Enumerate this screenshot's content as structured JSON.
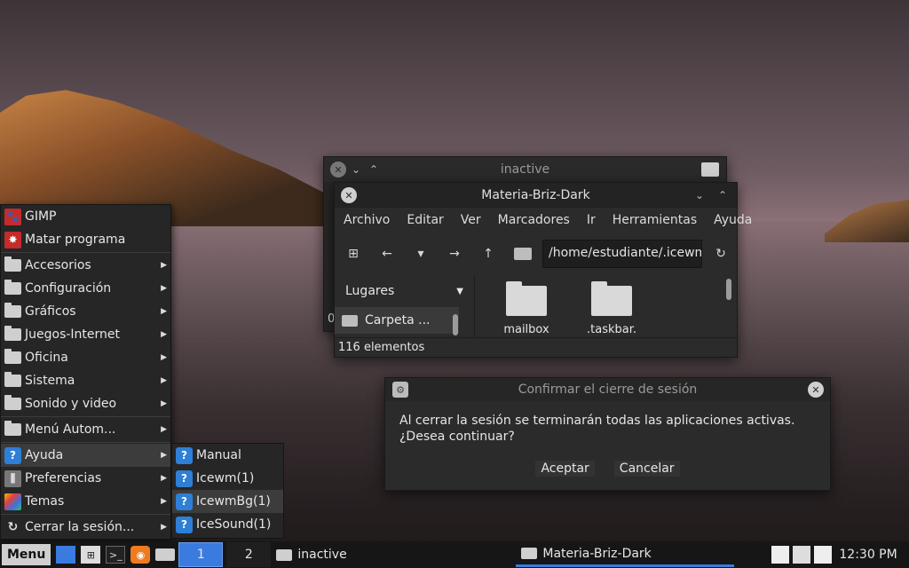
{
  "windows": {
    "inactive": {
      "title": "inactive",
      "close_icon": "close-icon",
      "min_icon": "chevron-down-icon",
      "max_icon": "chevron-up-icon",
      "status_fragment": "0"
    },
    "file_manager": {
      "title": "Materia-Briz-Dark",
      "menu": [
        "Archivo",
        "Editar",
        "Ver",
        "Marcadores",
        "Ir",
        "Herramientas",
        "Ayuda"
      ],
      "path": "/home/estudiante/.icewm",
      "sidebar_header": "Lugares",
      "sidebar_item": "Carpeta ...",
      "files": [
        "mailbox",
        ".taskbar."
      ],
      "status": "116 elementos"
    }
  },
  "dialog": {
    "title": "Confirmar el cierre de sesión",
    "message_line1": "Al cerrar la sesión se terminarán todas las aplicaciones activas.",
    "message_line2": "¿Desea continuar?",
    "accept": "Aceptar",
    "cancel": "Cancelar"
  },
  "start_menu": {
    "apps": [
      {
        "label": "GIMP",
        "icon": "gimp-icon"
      },
      {
        "label": "Matar programa",
        "icon": "kill-icon"
      }
    ],
    "categories": [
      "Accesorios",
      "Configuración",
      "Gráficos",
      "Juegos-Internet",
      "Oficina",
      "Sistema",
      "Sonido y video"
    ],
    "auto_menu": "Menú Autom...",
    "ayuda": "Ayuda",
    "preferencias": "Preferencias",
    "temas": "Temas",
    "logout": "Cerrar la sesión..."
  },
  "submenu": [
    "Manual",
    "Icewm(1)",
    "IcewmBg(1)",
    "IceSound(1)"
  ],
  "taskbar": {
    "menu_label": "Menu",
    "workspaces": [
      "1",
      "2"
    ],
    "tasks": [
      "inactive",
      "Materia-Briz-Dark"
    ],
    "clock": "12:30 PM"
  }
}
